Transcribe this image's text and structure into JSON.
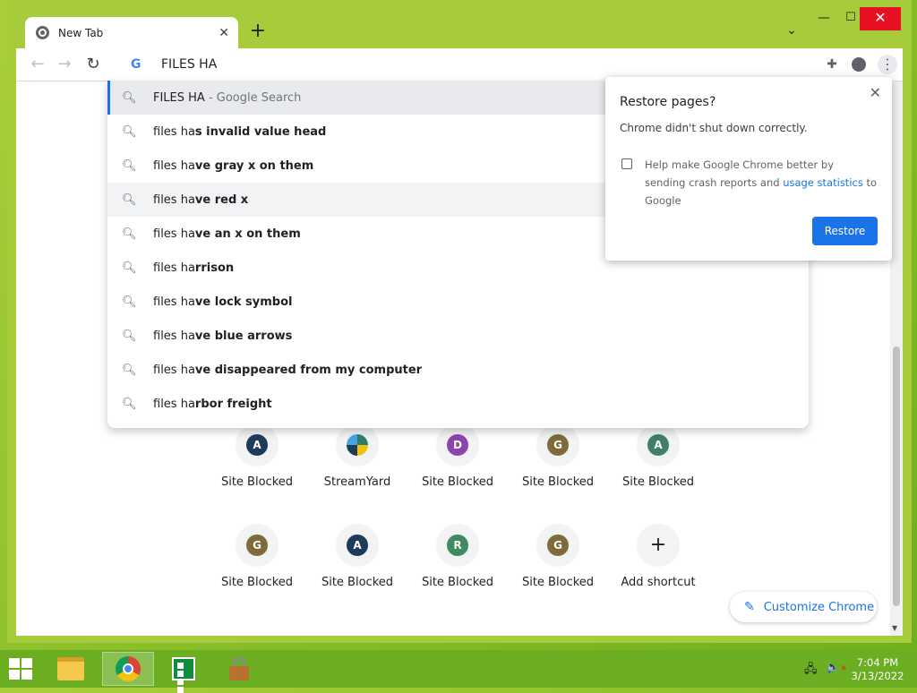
{
  "browser": {
    "tab_title": "New Tab",
    "tab_close": "✕",
    "new_tab": "+",
    "tab_search": "⌄",
    "win_min": "—",
    "win_max": "☐",
    "win_close": "✕"
  },
  "toolbar": {
    "back": "←",
    "forward": "→",
    "reload": "↻",
    "google_g": "G",
    "omnibox_text": "FILES HA",
    "extensions_icon": "✚",
    "menu_icon": "⋮"
  },
  "dropdown": {
    "search_icon": "🔍︎",
    "suggestions": [
      {
        "plain": "FILES HA",
        "bold": "",
        "sub": " - Google Search"
      },
      {
        "plain": "files ha",
        "bold": "s invalid value head",
        "sub": ""
      },
      {
        "plain": "files ha",
        "bold": "ve gray x on them",
        "sub": ""
      },
      {
        "plain": "files ha",
        "bold": "ve red x",
        "sub": ""
      },
      {
        "plain": "files ha",
        "bold": "ve an x on them",
        "sub": ""
      },
      {
        "plain": "files ha",
        "bold": "rrison",
        "sub": ""
      },
      {
        "plain": "files ha",
        "bold": "ve lock symbol",
        "sub": ""
      },
      {
        "plain": "files ha",
        "bold": "ve blue arrows",
        "sub": ""
      },
      {
        "plain": "files ha",
        "bold": "ve disappeared from my computer",
        "sub": ""
      },
      {
        "plain": "files ha",
        "bold": "rbor freight",
        "sub": ""
      }
    ]
  },
  "restore_bubble": {
    "title": "Restore pages?",
    "close": "✕",
    "message": "Chrome didn't shut down correctly.",
    "option_text": "Help make Google Chrome better by sending crash reports and ",
    "option_link": "usage statistics",
    "option_tail": " to Google",
    "restore_button": "Restore"
  },
  "shortcuts": [
    {
      "letter": "A",
      "label": "Site Blocked",
      "color": "#1f3b5a"
    },
    {
      "letter": "",
      "label": "StreamYard",
      "color": "#ffffff"
    },
    {
      "letter": "D",
      "label": "Site Blocked",
      "color": "#8e44ad"
    },
    {
      "letter": "G",
      "label": "Site Blocked",
      "color": "#7d6b3a"
    },
    {
      "letter": "A",
      "label": "Site Blocked",
      "color": "#3f7f6b"
    },
    {
      "letter": "G",
      "label": "Site Blocked",
      "color": "#7d6b3a"
    },
    {
      "letter": "A",
      "label": "Site Blocked",
      "color": "#1f3b5a"
    },
    {
      "letter": "R",
      "label": "Site Blocked",
      "color": "#3f8a5e"
    },
    {
      "letter": "G",
      "label": "Site Blocked",
      "color": "#7d6b3a"
    },
    {
      "letter": "+",
      "label": "Add shortcut",
      "color": "#f1f3f4"
    }
  ],
  "customize": {
    "icon": "✎",
    "label": "Customize Chrome"
  },
  "taskbar": {
    "time": "7:04 PM",
    "date": "3/13/2022",
    "network_icon": "🖧",
    "volume_icon": "🔈"
  }
}
